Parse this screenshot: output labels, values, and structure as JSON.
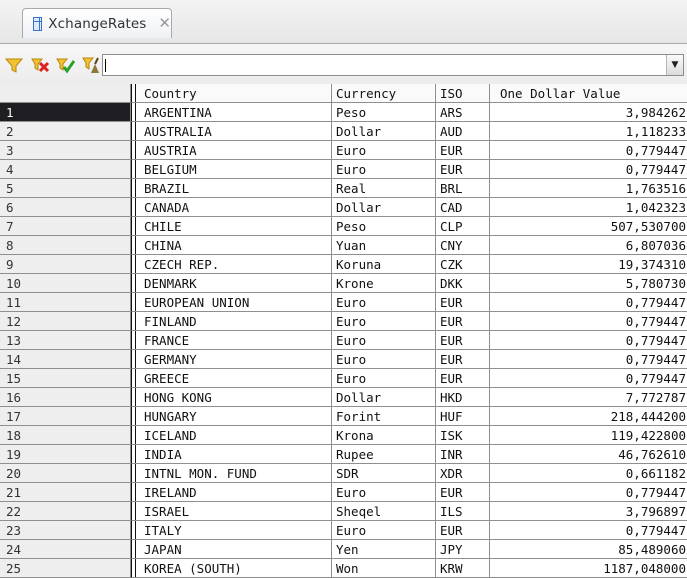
{
  "window": {
    "tab_title": "XchangeRates",
    "tab_close": "✕"
  },
  "toolbar": {
    "icons": [
      "filter-icon",
      "delete-filter-icon",
      "apply-filter-icon",
      "clear-filter-icon"
    ],
    "filter_value": "",
    "dropdown_arrow": "▼"
  },
  "grid": {
    "columns": [
      "Country",
      "Currency",
      "ISO",
      "One Dollar Value"
    ],
    "selected_row": 1,
    "rows": [
      {
        "no": "1",
        "country": "ARGENTINA",
        "currency": "Peso",
        "iso": "ARS",
        "value": "3,984262"
      },
      {
        "no": "2",
        "country": "AUSTRALIA",
        "currency": "Dollar",
        "iso": "AUD",
        "value": "1,118233"
      },
      {
        "no": "3",
        "country": "AUSTRIA",
        "currency": "Euro",
        "iso": "EUR",
        "value": "0,779447"
      },
      {
        "no": "4",
        "country": "BELGIUM",
        "currency": "Euro",
        "iso": "EUR",
        "value": "0,779447"
      },
      {
        "no": "5",
        "country": "BRAZIL",
        "currency": "Real",
        "iso": "BRL",
        "value": "1,763516"
      },
      {
        "no": "6",
        "country": "CANADA",
        "currency": "Dollar",
        "iso": "CAD",
        "value": "1,042323"
      },
      {
        "no": "7",
        "country": "CHILE",
        "currency": "Peso",
        "iso": "CLP",
        "value": "507,530700"
      },
      {
        "no": "8",
        "country": "CHINA",
        "currency": "Yuan",
        "iso": "CNY",
        "value": "6,807036"
      },
      {
        "no": "9",
        "country": "CZECH REP.",
        "currency": "Koruna",
        "iso": "CZK",
        "value": "19,374310"
      },
      {
        "no": "10",
        "country": "DENMARK",
        "currency": "Krone",
        "iso": "DKK",
        "value": "5,780730"
      },
      {
        "no": "11",
        "country": "EUROPEAN UNION",
        "currency": "Euro",
        "iso": "EUR",
        "value": "0,779447"
      },
      {
        "no": "12",
        "country": "FINLAND",
        "currency": "Euro",
        "iso": "EUR",
        "value": "0,779447"
      },
      {
        "no": "13",
        "country": "FRANCE",
        "currency": "Euro",
        "iso": "EUR",
        "value": "0,779447"
      },
      {
        "no": "14",
        "country": "GERMANY",
        "currency": "Euro",
        "iso": "EUR",
        "value": "0,779447"
      },
      {
        "no": "15",
        "country": "GREECE",
        "currency": "Euro",
        "iso": "EUR",
        "value": "0,779447"
      },
      {
        "no": "16",
        "country": "HONG KONG",
        "currency": "Dollar",
        "iso": "HKD",
        "value": "7,772787"
      },
      {
        "no": "17",
        "country": "HUNGARY",
        "currency": "Forint",
        "iso": "HUF",
        "value": "218,444200"
      },
      {
        "no": "18",
        "country": "ICELAND",
        "currency": "Krona",
        "iso": "ISK",
        "value": "119,422800"
      },
      {
        "no": "19",
        "country": "INDIA",
        "currency": "Rupee",
        "iso": "INR",
        "value": "46,762610"
      },
      {
        "no": "20",
        "country": "INTNL MON. FUND",
        "currency": "SDR",
        "iso": "XDR",
        "value": "0,661182"
      },
      {
        "no": "21",
        "country": "IRELAND",
        "currency": "Euro",
        "iso": "EUR",
        "value": "0,779447"
      },
      {
        "no": "22",
        "country": "ISRAEL",
        "currency": "Sheqel",
        "iso": "ILS",
        "value": "3,796897"
      },
      {
        "no": "23",
        "country": "ITALY",
        "currency": "Euro",
        "iso": "EUR",
        "value": "0,779447"
      },
      {
        "no": "24",
        "country": "JAPAN",
        "currency": "Yen",
        "iso": "JPY",
        "value": "85,489060"
      },
      {
        "no": "25",
        "country": "KOREA (SOUTH)",
        "currency": "Won",
        "iso": "KRW",
        "value": "1187,048000"
      }
    ]
  }
}
